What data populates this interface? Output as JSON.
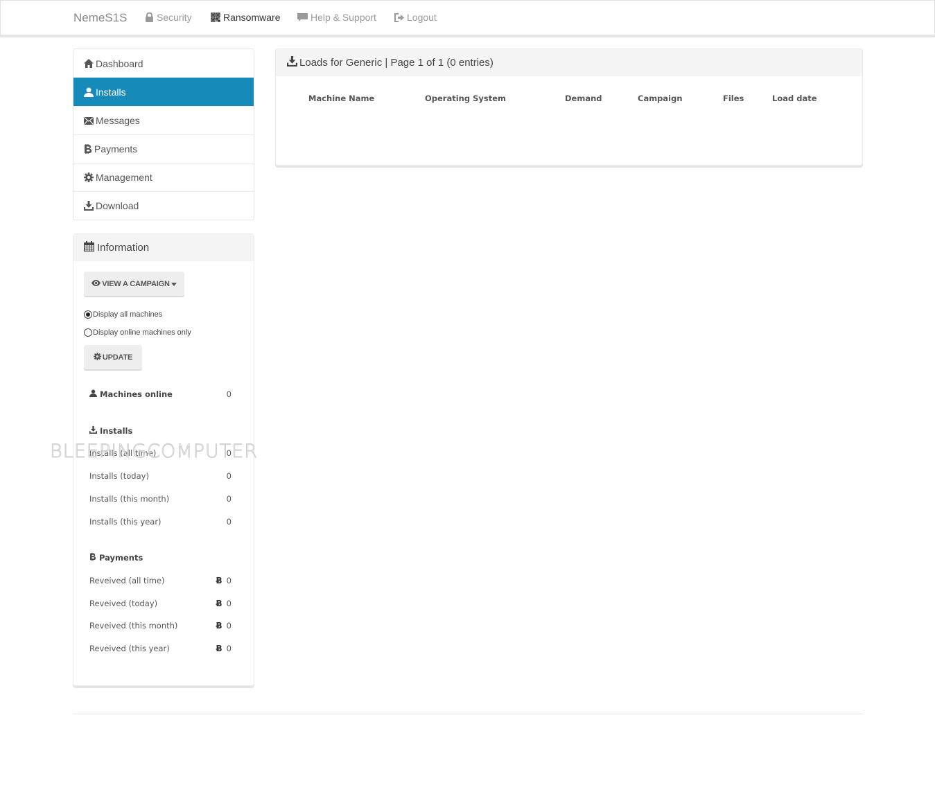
{
  "navbar": {
    "brand": "NemeS1S",
    "links": [
      {
        "label": "Security",
        "icon": "lock-icon",
        "active": false
      },
      {
        "label": "Ransomware",
        "icon": "qrcode-icon",
        "active": true
      },
      {
        "label": "Help & Support",
        "icon": "comment-icon",
        "active": false
      },
      {
        "label": "Logout",
        "icon": "logout-icon",
        "active": false
      }
    ]
  },
  "sidebar": {
    "items": [
      {
        "label": "Dashboard",
        "icon": "home-icon",
        "active": false
      },
      {
        "label": "Installs",
        "icon": "user-icon",
        "active": true
      },
      {
        "label": "Messages",
        "icon": "envelope-icon",
        "active": false
      },
      {
        "label": "Payments",
        "icon": "bitcoin-icon",
        "active": false
      },
      {
        "label": "Management",
        "icon": "gear-icon",
        "active": false
      },
      {
        "label": "Download",
        "icon": "download-icon",
        "active": false
      }
    ]
  },
  "info": {
    "title": "Information",
    "view_campaign_label": "VIEW A CAMPAIGN",
    "radio_all_label": "Display all machines",
    "radio_online_label": "Display online machines only",
    "radio_selected": "all",
    "update_label": "UPDATE",
    "machines_online_label": "Machines online",
    "machines_online_value": "0",
    "installs_heading": "Installs",
    "installs": [
      {
        "label": "Installs (all time)",
        "value": "0"
      },
      {
        "label": "Installs (today)",
        "value": "0"
      },
      {
        "label": "Installs (this month)",
        "value": "0"
      },
      {
        "label": "Installs (this year)",
        "value": "0"
      }
    ],
    "payments_heading": "Payments",
    "currency_symbol": "Ƀ",
    "payments": [
      {
        "label": "Reveived (all time)",
        "value": "0"
      },
      {
        "label": "Reveived (today)",
        "value": "0"
      },
      {
        "label": "Reveived (this month)",
        "value": "0"
      },
      {
        "label": "Reveived (this year)",
        "value": "0"
      }
    ]
  },
  "main": {
    "title": "Loads for Generic | Page 1 of 1 (0 entries)",
    "columns": [
      "Machine Name",
      "Operating System",
      "Demand",
      "Campaign",
      "Files",
      "Load date"
    ],
    "rows": []
  },
  "watermark": "BLEEPINGCOMPUTER",
  "colors": {
    "accent": "#168bba",
    "panel_header": "#f4f4f4",
    "button": "#eeeeee"
  }
}
